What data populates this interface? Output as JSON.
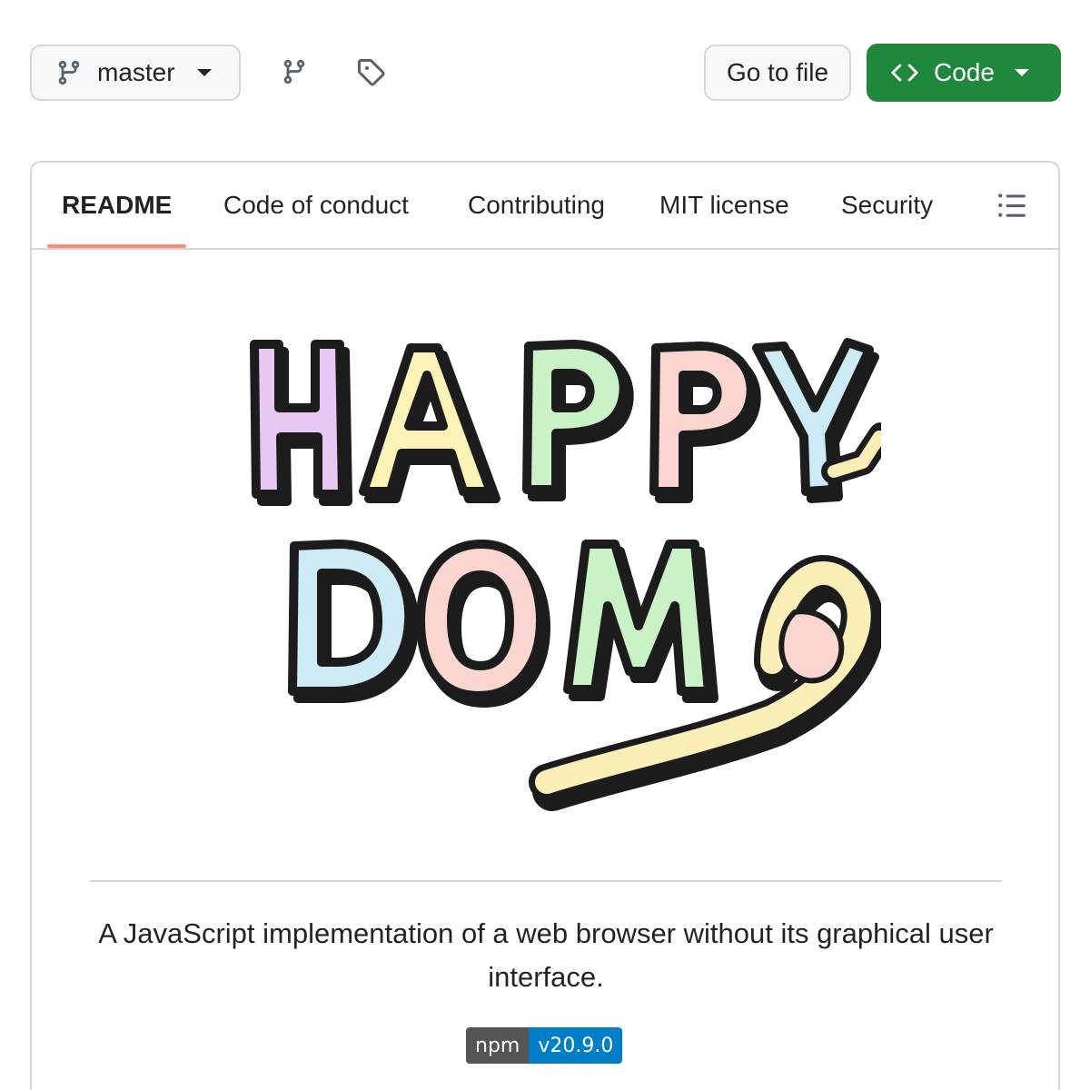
{
  "toolbar": {
    "branch_icon": "git-branch-icon",
    "branch_label": "master",
    "branches_icon": "git-branch-icon",
    "tags_icon": "tag-icon",
    "goto_file_label": "Go to file",
    "code_icon": "code-icon",
    "code_label": "Code",
    "code_button_color": "#1f883d"
  },
  "readme": {
    "tabs": [
      {
        "label": "README",
        "active": true
      },
      {
        "label": "Code of conduct",
        "active": false
      },
      {
        "label": "Contributing",
        "active": false
      },
      {
        "label": "MIT license",
        "active": false
      },
      {
        "label": "Security",
        "active": false
      }
    ],
    "outline_icon": "list-unordered-icon",
    "active_tab_underline_color": "#fd8c73",
    "logo_text": "HAPPY DOM",
    "description": "A JavaScript implementation of a web browser without its graphical user interface.",
    "badge": {
      "label": "npm",
      "value": "v20.9.0",
      "value_color": "#007ec6"
    }
  }
}
